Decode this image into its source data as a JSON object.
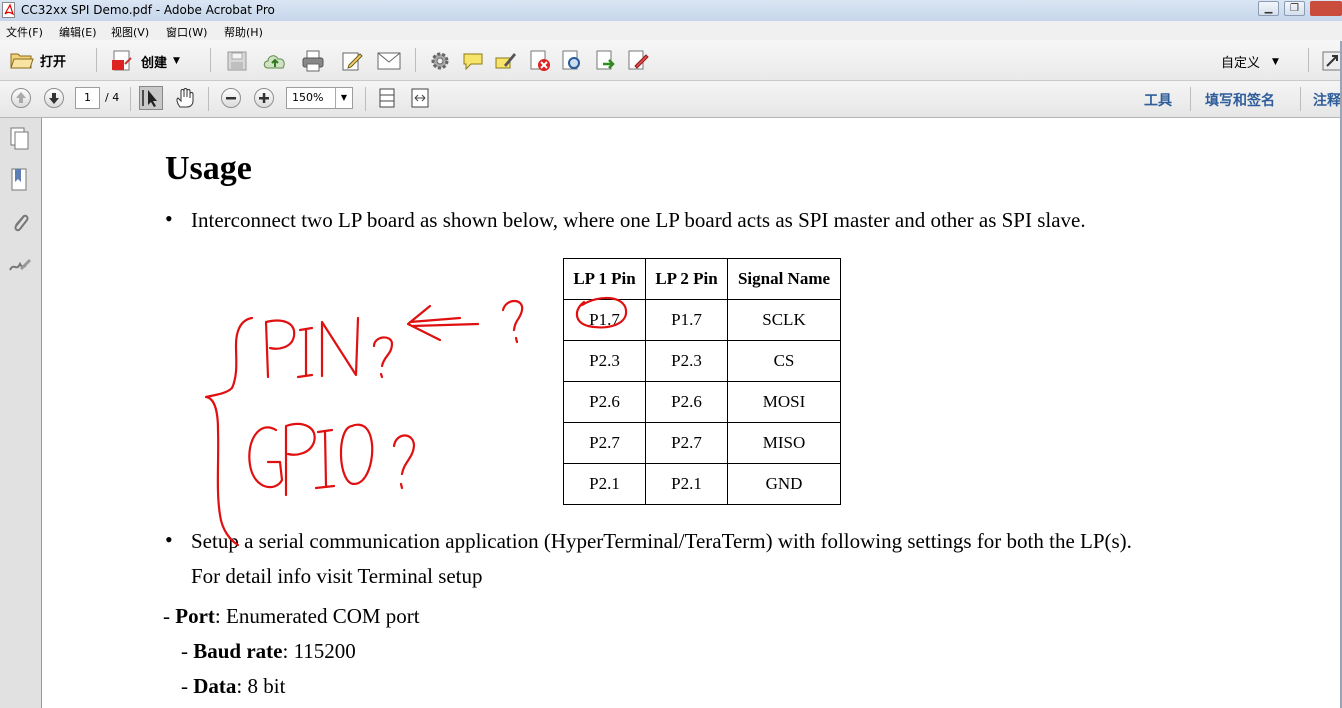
{
  "window": {
    "title": "CC32xx SPI Demo.pdf - Adobe Acrobat Pro",
    "buttons": [
      "minimize",
      "restore"
    ]
  },
  "menubar": {
    "items": [
      "文件(F)",
      "编辑(E)",
      "视图(V)",
      "窗口(W)",
      "帮助(H)"
    ]
  },
  "toolbar": {
    "open_label": "打开",
    "create_label": "创建",
    "customize_label": "自定义",
    "icons": [
      "open-folder-icon",
      "create-pdf-icon",
      "save-icon",
      "upload-icon",
      "print-icon",
      "edit-icon",
      "email-icon",
      "settings-icon",
      "comment-icon",
      "highlight-icon",
      "delete-icon",
      "search-doc-icon",
      "export-icon",
      "sign-icon"
    ]
  },
  "navbar": {
    "page_current": "1",
    "page_total": "/ 4",
    "zoom": "150%",
    "tools_label": "工具",
    "fill_sign_label": "填写和签名",
    "comment_label": "注释"
  },
  "document": {
    "heading": "Usage",
    "bullet1": "Interconnect two LP board as shown below, where one LP board acts as SPI master and other as SPI slave.",
    "table": {
      "headers": [
        "LP 1 Pin",
        "LP 2 Pin",
        "Signal Name"
      ],
      "rows": [
        [
          "P1.7",
          "P1.7",
          "SCLK"
        ],
        [
          "P2.3",
          "P2.3",
          "CS"
        ],
        [
          "P2.6",
          "P2.6",
          "MOSI"
        ],
        [
          "P2.7",
          "P2.7",
          "MISO"
        ],
        [
          "P2.1",
          "P2.1",
          "GND"
        ]
      ]
    },
    "bullet2_line1": "Setup a serial communication application (HyperTerminal/TeraTerm) with following settings for both the LP(s).",
    "bullet2_line2": "For detail info visit Terminal setup",
    "settings": [
      {
        "prefix": "- ",
        "key": "Port",
        "value": ": Enumerated COM port"
      },
      {
        "prefix": "- ",
        "key": "Baud rate",
        "value": ": 115200"
      },
      {
        "prefix": "- ",
        "key": "Data",
        "value": ": 8 bit"
      }
    ]
  },
  "annotation": {
    "color": "#e01010",
    "text": [
      "PIN?",
      "?",
      "GPIO?"
    ]
  }
}
